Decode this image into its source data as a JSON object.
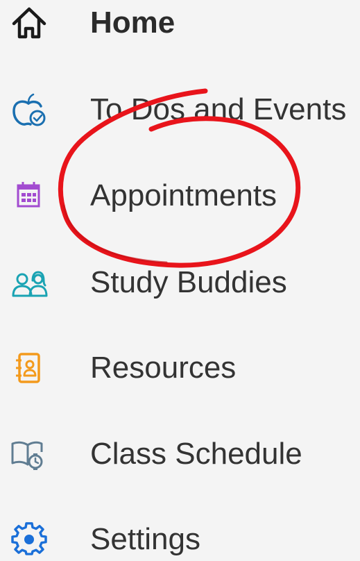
{
  "nav": {
    "items": [
      {
        "label": "Home",
        "icon": "home-icon"
      },
      {
        "label": "To Dos and Events",
        "icon": "apple-check-icon"
      },
      {
        "label": "Appointments",
        "icon": "calendar-icon"
      },
      {
        "label": "Study Buddies",
        "icon": "people-icon"
      },
      {
        "label": "Resources",
        "icon": "contact-book-icon"
      },
      {
        "label": "Class Schedule",
        "icon": "book-clock-icon"
      },
      {
        "label": "Settings",
        "icon": "gear-icon"
      }
    ]
  },
  "annotation": {
    "shape": "hand-drawn circle",
    "target": "Appointments",
    "color": "#e8141b"
  },
  "colors": {
    "text": "#333333",
    "home_icon": "#1a1a1a",
    "todos_icon": "#1a6fb0",
    "appointments_icon": "#a24bd0",
    "study_icon": "#1aa3b3",
    "resources_icon": "#f39a1c",
    "schedule_icon": "#607d92",
    "settings_icon": "#1a6fd8"
  }
}
